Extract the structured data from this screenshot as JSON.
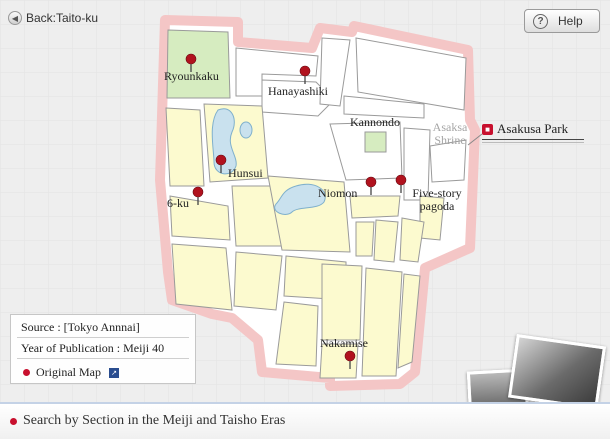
{
  "nav": {
    "back_label": "Back:Taito-ku",
    "help_label": "Help"
  },
  "map": {
    "labels": {
      "ryounkaku": "Ryounkaku",
      "hanayashiki": "Hanayashiki",
      "kannondo": "Kannondo",
      "asakusa_shrine": "Asaksa Shrine",
      "hunsui": "Hunsui",
      "sixku": "6-ku",
      "niomon": "Niomon",
      "five_story_pagoda": "Five-story pagoda",
      "nakamise": "Nakamise"
    },
    "park_label": "Asakusa Park"
  },
  "info": {
    "source": "Source : [Tokyo Annnai]",
    "year": "Year of Publication : Meiji 40",
    "original_map": "Original Map"
  },
  "footer": {
    "search_label": "Search by Section in the Meiji and Taisho Eras"
  },
  "colors": {
    "accent": "#c8102e",
    "map_yellow": "#fcfacf",
    "map_green": "#d6ecc0",
    "water": "#c9e1ee",
    "grid": "#e4e4e4"
  }
}
